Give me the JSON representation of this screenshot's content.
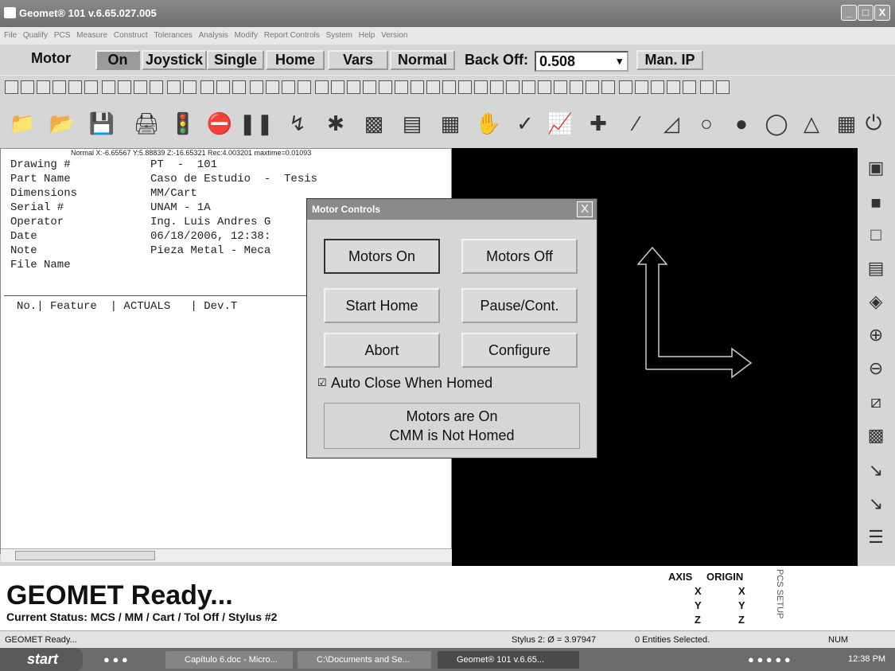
{
  "window": {
    "title": "Geomet® 101 v.6.65.027.005",
    "buttons": [
      "_",
      "□",
      "X"
    ]
  },
  "menu": [
    "File",
    "Qualify",
    "PCS",
    "Measure",
    "Construct",
    "Tolerances",
    "Analysis",
    "Modify",
    "Report Controls",
    "System",
    "Help",
    "Version"
  ],
  "motorbar": {
    "motor": "Motor",
    "on": "On",
    "joystick": "Joystick",
    "single": "Single",
    "home": "Home",
    "vars": "Vars",
    "normal": "Normal",
    "backoff_label": "Back Off:",
    "backoff_value": "0.508",
    "dropdown": "▾",
    "manip": "Man. IP"
  },
  "coords": "Normal X:-6.65567 Y:5.88839 Z:-16.65321 Rec:4.003201 maxtime=0.01093",
  "header": [
    {
      "k": "Drawing #",
      "v": "PT  -  101"
    },
    {
      "k": "Part Name",
      "v": "Caso de Estudio  -  Tesis"
    },
    {
      "k": "Dimensions",
      "v": "MM/Cart"
    },
    {
      "k": "Serial #",
      "v": "UNAM - 1A"
    },
    {
      "k": "Operator",
      "v": "Ing. Luis Andres G"
    },
    {
      "k": "Date",
      "v": "06/18/2006, 12:38:"
    },
    {
      "k": "Note",
      "v": "Pieza Metal - Meca"
    },
    {
      "k": "File Name",
      "v": ""
    }
  ],
  "columns": "No.| Feature  | ACTUALS   | Dev.T",
  "dialog": {
    "title": "Motor Controls",
    "close": "X",
    "motors_on": "Motors On",
    "motors_off": "Motors Off",
    "start_home": "Start Home",
    "pause": "Pause/Cont.",
    "abort": "Abort",
    "configure": "Configure",
    "check_mark": "☑",
    "autoclose": "Auto Close When Homed",
    "status1": "Motors are  On",
    "status2": "CMM is Not Homed"
  },
  "status": {
    "ready": "GEOMET Ready...",
    "current": "Current Status: MCS / MM / Cart / Tol Off / Stylus #2",
    "axis": "AXIS",
    "origin": "ORIGIN",
    "x": "X",
    "y": "Y",
    "z": "Z",
    "pcs": "PCS SETUP"
  },
  "statusbar": {
    "left": "GEOMET Ready...",
    "stylus": "Stylus 2: Ø = 3.97947",
    "entities": "0 Entities Selected.",
    "num": "NUM"
  },
  "taskbar": {
    "start": "start",
    "items": [
      "Capítulo 6.doc - Micro...",
      "C:\\Documents and Se...",
      "Geomet® 101 v.6.65..."
    ],
    "clock": "12:38 PM"
  }
}
